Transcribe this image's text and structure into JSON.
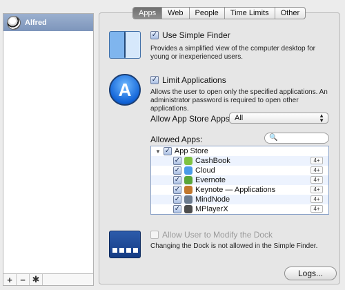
{
  "users": {
    "items": [
      {
        "name": "Alfred"
      }
    ],
    "footer": {
      "add": "+",
      "remove": "−",
      "gear": "✱"
    }
  },
  "tabs": [
    {
      "label": "Apps",
      "active": true
    },
    {
      "label": "Web"
    },
    {
      "label": "People"
    },
    {
      "label": "Time Limits"
    },
    {
      "label": "Other"
    }
  ],
  "simple_finder": {
    "label": "Use Simple Finder",
    "checked": true,
    "description": "Provides a simplified view of the computer desktop for young or inexperienced users."
  },
  "limit_apps": {
    "label": "Limit Applications",
    "checked": true,
    "description": "Allows the user to open only the specified applications. An administrator password is required to open other applications."
  },
  "app_store_apps": {
    "label": "Allow App Store Apps:",
    "value": "All"
  },
  "allowed_apps": {
    "label": "Allowed Apps:",
    "search_placeholder": "",
    "group": "App Store",
    "items": [
      {
        "name": "CashBook",
        "rating": "4+",
        "icon_color": "#7fc241"
      },
      {
        "name": "Cloud",
        "rating": "4+",
        "icon_color": "#4a9be8"
      },
      {
        "name": "Evernote",
        "rating": "4+",
        "icon_color": "#5aa63a"
      },
      {
        "name": "Keynote — Applications",
        "rating": "4+",
        "icon_color": "#c2782e"
      },
      {
        "name": "MindNode",
        "rating": "4+",
        "icon_color": "#6b7b8f"
      },
      {
        "name": "MPlayerX",
        "rating": "4+",
        "icon_color": "#4d4d4d"
      }
    ]
  },
  "modify_dock": {
    "label": "Allow User to Modify the Dock",
    "checked": false,
    "enabled": false,
    "description": "Changing the Dock is not allowed in the Simple Finder."
  },
  "logs_button": {
    "label": "Logs..."
  }
}
